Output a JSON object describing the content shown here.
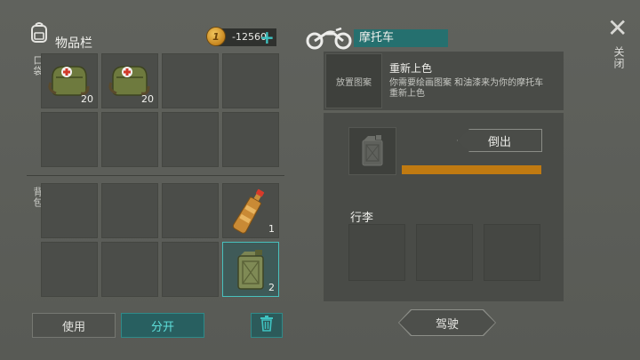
{
  "inventory": {
    "title": "物品栏",
    "coins": "-12560",
    "plus": "+",
    "pocket_label": "口袋",
    "backpack_label": "背包",
    "pocket_slots": [
      {
        "item": "medkit-bag",
        "count": "20"
      },
      {
        "item": "medkit-bag",
        "count": "20"
      },
      {
        "item": "",
        "count": ""
      },
      {
        "item": "",
        "count": ""
      },
      {
        "item": "",
        "count": ""
      },
      {
        "item": "",
        "count": ""
      },
      {
        "item": "",
        "count": ""
      },
      {
        "item": "",
        "count": ""
      }
    ],
    "backpack_slots": [
      {
        "item": "",
        "count": ""
      },
      {
        "item": "",
        "count": ""
      },
      {
        "item": "",
        "count": ""
      },
      {
        "item": "fuel-bottle",
        "count": "1"
      },
      {
        "item": "",
        "count": ""
      },
      {
        "item": "",
        "count": ""
      },
      {
        "item": "",
        "count": ""
      },
      {
        "item": "jerrycan",
        "count": "2",
        "selected": true
      }
    ]
  },
  "actions": {
    "use_label": "使用",
    "split_label": "分开"
  },
  "vehicle": {
    "name": "摩托车",
    "repaint_title": "重新上色",
    "repaint_desc_1": "你需要绘画图案 和油漆来为你的摩托车",
    "repaint_desc_2": "重新上色",
    "place_label": "放置图案",
    "pour_label": "倒出",
    "fuel_level": 1.0,
    "luggage_label": "行李",
    "drive_label": "驾驶"
  },
  "close": {
    "icon": "close-icon",
    "label": "关闭"
  },
  "colors": {
    "accent": "#25706f",
    "split_text": "#5fe0dc",
    "fuel": "#c07a11",
    "selected_border": "#48c0bd"
  }
}
